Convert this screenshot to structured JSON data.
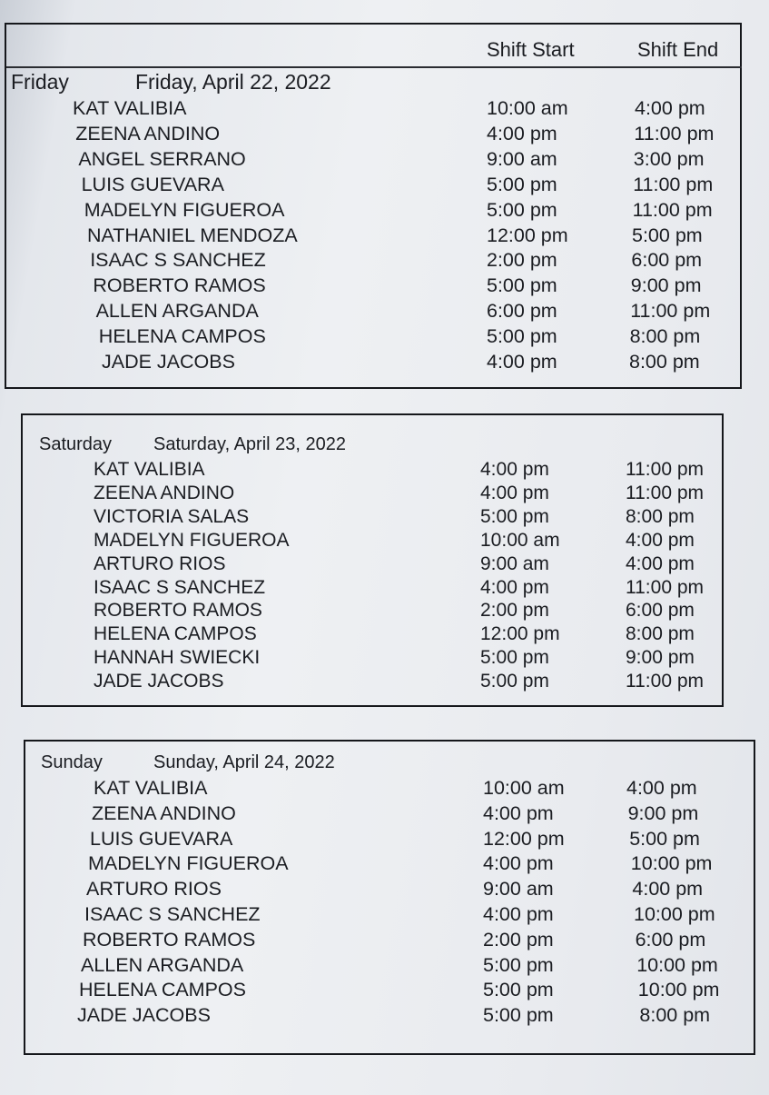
{
  "header": {
    "shift_start": "Shift Start",
    "shift_end": "Shift End"
  },
  "days": [
    {
      "day": "Friday",
      "date": "Friday, April 22, 2022",
      "rows": [
        {
          "name": "KAT VALIBIA",
          "start": "10:00 am",
          "end": "4:00 pm"
        },
        {
          "name": "ZEENA ANDINO",
          "start": "4:00 pm",
          "end": "11:00 pm"
        },
        {
          "name": "ANGEL SERRANO",
          "start": "9:00 am",
          "end": "3:00 pm"
        },
        {
          "name": "LUIS GUEVARA",
          "start": "5:00 pm",
          "end": "11:00 pm"
        },
        {
          "name": "MADELYN FIGUEROA",
          "start": "5:00 pm",
          "end": "11:00 pm"
        },
        {
          "name": "NATHANIEL MENDOZA",
          "start": "12:00 pm",
          "end": "5:00 pm"
        },
        {
          "name": "ISAAC S SANCHEZ",
          "start": "2:00 pm",
          "end": "6:00 pm"
        },
        {
          "name": "ROBERTO RAMOS",
          "start": "5:00 pm",
          "end": "9:00 pm"
        },
        {
          "name": "ALLEN ARGANDA",
          "start": "6:00 pm",
          "end": "11:00 pm"
        },
        {
          "name": "HELENA CAMPOS",
          "start": "5:00 pm",
          "end": "8:00 pm"
        },
        {
          "name": "JADE JACOBS",
          "start": "4:00 pm",
          "end": "8:00 pm"
        }
      ]
    },
    {
      "day": "Saturday",
      "date": "Saturday, April 23, 2022",
      "rows": [
        {
          "name": "KAT VALIBIA",
          "start": "4:00 pm",
          "end": "11:00 pm"
        },
        {
          "name": "ZEENA ANDINO",
          "start": "4:00 pm",
          "end": "11:00 pm"
        },
        {
          "name": "VICTORIA SALAS",
          "start": "5:00 pm",
          "end": "8:00 pm"
        },
        {
          "name": "MADELYN FIGUEROA",
          "start": "10:00 am",
          "end": "4:00 pm"
        },
        {
          "name": "ARTURO RIOS",
          "start": "9:00 am",
          "end": "4:00 pm"
        },
        {
          "name": "ISAAC S SANCHEZ",
          "start": "4:00 pm",
          "end": "11:00 pm"
        },
        {
          "name": "ROBERTO RAMOS",
          "start": "2:00 pm",
          "end": "6:00 pm"
        },
        {
          "name": "HELENA CAMPOS",
          "start": "12:00 pm",
          "end": "8:00 pm"
        },
        {
          "name": "HANNAH SWIECKI",
          "start": "5:00 pm",
          "end": "9:00 pm"
        },
        {
          "name": "JADE JACOBS",
          "start": "5:00 pm",
          "end": "11:00 pm"
        }
      ]
    },
    {
      "day": "Sunday",
      "date": "Sunday, April 24, 2022",
      "rows": [
        {
          "name": "KAT VALIBIA",
          "start": "10:00 am",
          "end": "4:00 pm"
        },
        {
          "name": "ZEENA ANDINO",
          "start": "4:00 pm",
          "end": "9:00 pm"
        },
        {
          "name": "LUIS GUEVARA",
          "start": "12:00 pm",
          "end": "5:00 pm"
        },
        {
          "name": "MADELYN FIGUEROA",
          "start": "4:00 pm",
          "end": "10:00 pm"
        },
        {
          "name": "ARTURO RIOS",
          "start": "9:00 am",
          "end": "4:00 pm"
        },
        {
          "name": "ISAAC S SANCHEZ",
          "start": "4:00 pm",
          "end": "10:00 pm"
        },
        {
          "name": "ROBERTO RAMOS",
          "start": "2:00 pm",
          "end": "6:00 pm"
        },
        {
          "name": "ALLEN ARGANDA",
          "start": "5:00 pm",
          "end": "10:00 pm"
        },
        {
          "name": "HELENA CAMPOS",
          "start": "5:00 pm",
          "end": "10:00 pm"
        },
        {
          "name": "JADE JACOBS",
          "start": "5:00 pm",
          "end": "8:00 pm"
        }
      ]
    }
  ]
}
